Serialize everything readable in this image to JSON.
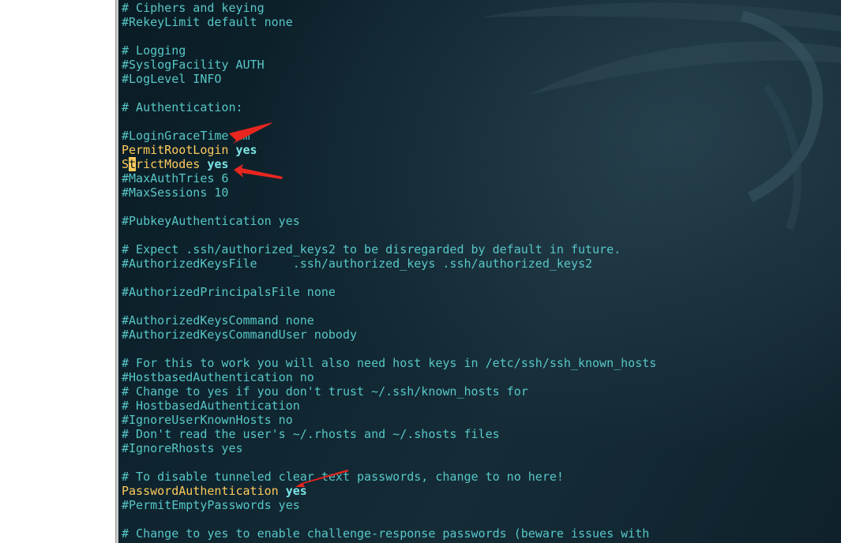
{
  "editor": {
    "lines": [
      "# Ciphers and keying",
      "#RekeyLimit default none",
      "",
      "# Logging",
      "#SyslogFacility AUTH",
      "#LogLevel INFO",
      "",
      "# Authentication:",
      "",
      "#LoginGraceTime 2m",
      "",
      "",
      "#MaxAuthTries 6",
      "#MaxSessions 10",
      "",
      "#PubkeyAuthentication yes",
      "",
      "# Expect .ssh/authorized_keys2 to be disregarded by default in future.",
      "#AuthorizedKeysFile     .ssh/authorized_keys .ssh/authorized_keys2",
      "",
      "#AuthorizedPrincipalsFile none",
      "",
      "#AuthorizedKeysCommand none",
      "#AuthorizedKeysCommandUser nobody",
      "",
      "# For this to work you will also need host keys in /etc/ssh/ssh_known_hosts",
      "#HostbasedAuthentication no",
      "# Change to yes if you don't trust ~/.ssh/known_hosts for",
      "# HostbasedAuthentication",
      "#IgnoreUserKnownHosts no",
      "# Don't read the user's ~/.rhosts and ~/.shosts files",
      "#IgnoreRhosts yes",
      "",
      "# To disable tunneled clear text passwords, change to no here!",
      "",
      "#PermitEmptyPasswords yes",
      "",
      "# Change to yes to enable challenge-response passwords (beware issues with"
    ],
    "permit_root_login": {
      "key": "PermitRootLogin",
      "value": "yes"
    },
    "strict_modes": {
      "key_first": "S",
      "cursor_char": "t",
      "key_rest": "rictModes",
      "value": "yes"
    },
    "password_auth": {
      "key": "PasswordAuthentication",
      "value": "yes"
    }
  },
  "colors": {
    "comment": "#57c7c7",
    "keyword": "#ffcb5b",
    "value": "#7be3e3",
    "arrow": "#e8261f",
    "background": "#0f2530"
  }
}
